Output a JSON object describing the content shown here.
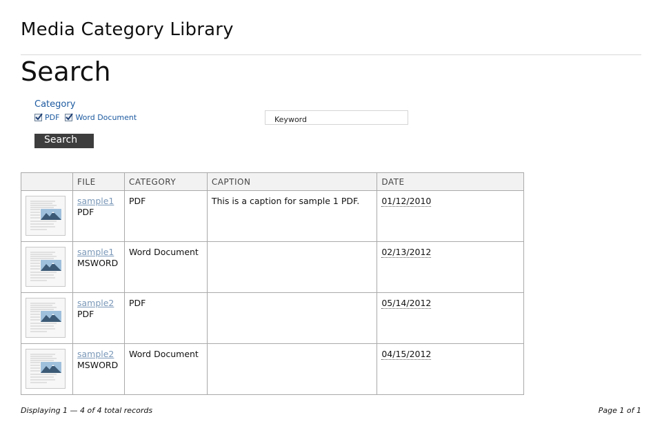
{
  "header": {
    "site_title": "Media Category Library",
    "page_title": "Search"
  },
  "filters": {
    "category_heading": "Category",
    "options": [
      {
        "label": "PDF",
        "checked": true
      },
      {
        "label": "Word Document",
        "checked": true
      }
    ],
    "keyword_value": "Keyword",
    "search_label": "Search"
  },
  "table": {
    "columns": [
      "",
      "FILE",
      "CATEGORY",
      "CAPTION",
      "DATE"
    ],
    "rows": [
      {
        "file_name": "sample1",
        "file_type": "PDF",
        "category": "PDF",
        "caption": "This is a caption for sample 1 PDF.",
        "date": "01/12/2010"
      },
      {
        "file_name": "sample1",
        "file_type": "MSWORD",
        "category": "Word Document",
        "caption": "",
        "date": "02/13/2012"
      },
      {
        "file_name": "sample2",
        "file_type": "PDF",
        "category": "PDF",
        "caption": "",
        "date": "05/14/2012"
      },
      {
        "file_name": "sample2",
        "file_type": "MSWORD",
        "category": "Word Document",
        "caption": "",
        "date": "04/15/2012"
      }
    ]
  },
  "footer": {
    "records_text": "Displaying 1 — 4 of 4 total records",
    "page_text": "Page 1 of 1"
  },
  "colors": {
    "link": "#7a98b8",
    "category_text": "#1d5aa0",
    "button_bg": "#3d3d3d",
    "header_bg": "#f2f2f2"
  }
}
